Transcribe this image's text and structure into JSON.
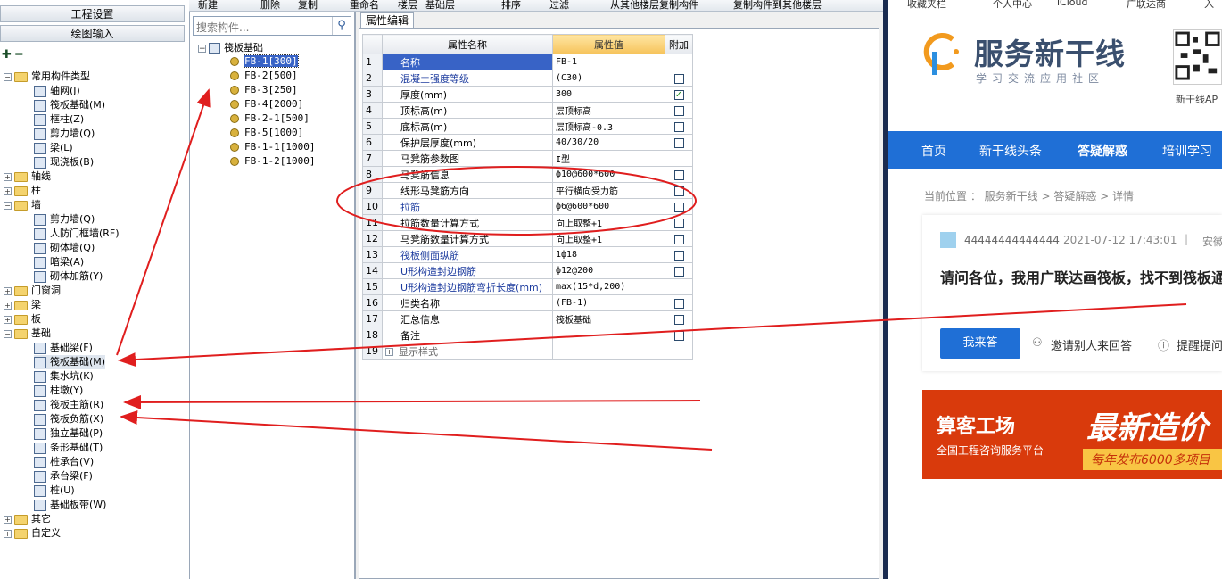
{
  "left_nav": {
    "buttons": [
      "工程设置",
      "绘图输入"
    ],
    "tree": [
      {
        "label": "常用构件类型",
        "level": 0,
        "expanded": true
      },
      {
        "label": "轴网(J)",
        "level": 1
      },
      {
        "label": "筏板基础(M)",
        "level": 1
      },
      {
        "label": "框柱(Z)",
        "level": 1
      },
      {
        "label": "剪力墙(Q)",
        "level": 1
      },
      {
        "label": "梁(L)",
        "level": 1
      },
      {
        "label": "现浇板(B)",
        "level": 1
      },
      {
        "label": "轴线",
        "level": 0,
        "expanded": false
      },
      {
        "label": "柱",
        "level": 0,
        "expanded": false
      },
      {
        "label": "墙",
        "level": 0,
        "expanded": true
      },
      {
        "label": "剪力墙(Q)",
        "level": 1
      },
      {
        "label": "人防门框墙(RF)",
        "level": 1
      },
      {
        "label": "砌体墙(Q)",
        "level": 1
      },
      {
        "label": "暗梁(A)",
        "level": 1
      },
      {
        "label": "砌体加筋(Y)",
        "level": 1
      },
      {
        "label": "门窗洞",
        "level": 0,
        "expanded": false
      },
      {
        "label": "梁",
        "level": 0,
        "expanded": false
      },
      {
        "label": "板",
        "level": 0,
        "expanded": false
      },
      {
        "label": "基础",
        "level": 0,
        "expanded": true
      },
      {
        "label": "基础梁(F)",
        "level": 1
      },
      {
        "label": "筏板基础(M)",
        "level": 1,
        "selected": true
      },
      {
        "label": "集水坑(K)",
        "level": 1
      },
      {
        "label": "柱墩(Y)",
        "level": 1
      },
      {
        "label": "筏板主筋(R)",
        "level": 1
      },
      {
        "label": "筏板负筋(X)",
        "level": 1
      },
      {
        "label": "独立基础(P)",
        "level": 1
      },
      {
        "label": "条形基础(T)",
        "level": 1
      },
      {
        "label": "桩承台(V)",
        "level": 1
      },
      {
        "label": "承台梁(F)",
        "level": 1
      },
      {
        "label": "桩(U)",
        "level": 1
      },
      {
        "label": "基础板带(W)",
        "level": 1
      },
      {
        "label": "其它",
        "level": 0,
        "expanded": false
      },
      {
        "label": "自定义",
        "level": 0,
        "expanded": false
      }
    ]
  },
  "toolbar": {
    "items": [
      "新建",
      "删除",
      "复制",
      "重命名",
      "楼层",
      "基础层",
      "排序",
      "过滤",
      "从其他楼层复制构件",
      "复制构件到其他楼层"
    ]
  },
  "components": {
    "search_placeholder": "搜索构件...",
    "root": "筏板基础",
    "items": [
      "FB-1[300]",
      "FB-2[500]",
      "FB-3[250]",
      "FB-4[2000]",
      "FB-2-1[500]",
      "FB-5[1000]",
      "FB-1-1[1000]",
      "FB-1-2[1000]"
    ]
  },
  "properties": {
    "tab": "属性编辑",
    "headers": {
      "name": "属性名称",
      "value": "属性值",
      "extra": "附加"
    },
    "rows": [
      {
        "n": "1",
        "name": "名称",
        "value": "FB-1",
        "blue": true,
        "check": null
      },
      {
        "n": "2",
        "name": "混凝土强度等级",
        "value": "(C30)",
        "blue": true,
        "check": false
      },
      {
        "n": "3",
        "name": "厚度(mm)",
        "value": "300",
        "blue": false,
        "check": true
      },
      {
        "n": "4",
        "name": "顶标高(m)",
        "value": "层顶标高",
        "blue": false,
        "check": false
      },
      {
        "n": "5",
        "name": "底标高(m)",
        "value": "层顶标高-0.3",
        "blue": false,
        "check": false
      },
      {
        "n": "6",
        "name": "保护层厚度(mm)",
        "value": "40/30/20",
        "blue": false,
        "check": false
      },
      {
        "n": "7",
        "name": "马凳筋参数图",
        "value": "I型",
        "blue": false,
        "check": null
      },
      {
        "n": "8",
        "name": "马凳筋信息",
        "value": "ф10@600*600",
        "blue": false,
        "check": false
      },
      {
        "n": "9",
        "name": "线形马凳筋方向",
        "value": "平行横向受力筋",
        "blue": false,
        "check": false
      },
      {
        "n": "10",
        "name": "拉筋",
        "value": "ф6@600*600",
        "blue": true,
        "check": false
      },
      {
        "n": "11",
        "name": "拉筋数量计算方式",
        "value": "向上取整+1",
        "blue": false,
        "check": false
      },
      {
        "n": "12",
        "name": "马凳筋数量计算方式",
        "value": "向上取整+1",
        "blue": false,
        "check": false
      },
      {
        "n": "13",
        "name": "筏板侧面纵筋",
        "value": "1ф18",
        "blue": true,
        "check": false
      },
      {
        "n": "14",
        "name": "U形构造封边钢筋",
        "value": "ф12@200",
        "blue": true,
        "check": false
      },
      {
        "n": "15",
        "name": "U形构造封边钢筋弯折长度(mm)",
        "value": "max(15*d,200)",
        "blue": true,
        "check": null
      },
      {
        "n": "16",
        "name": "归类名称",
        "value": "(FB-1)",
        "blue": false,
        "check": false
      },
      {
        "n": "17",
        "name": "汇总信息",
        "value": "筏板基础",
        "blue": false,
        "check": false
      },
      {
        "n": "18",
        "name": "备注",
        "value": "",
        "blue": false,
        "check": false
      },
      {
        "n": "19",
        "name": "显示样式",
        "value": "",
        "blue": false,
        "check": null,
        "expander": true
      }
    ]
  },
  "browser": {
    "bookmarks": [
      "收藏夹栏",
      "个人中心",
      "iCloud",
      "广联达商",
      "入"
    ],
    "logo_text": "服务新干线",
    "logo_sub": "学习交流应用社区",
    "qr_label": "新干线AP",
    "nav": [
      "首页",
      "新干线头条",
      "答疑解惑",
      "培训学习"
    ],
    "breadcrumb": "当前位置 ： 服务新干线 > 答疑解惑 > 详情",
    "question": {
      "user": "44444444444444",
      "time": "2021-07-12 17:43:01",
      "separator": "|",
      "tag": "安徽",
      "title": "请问各位，我用广联达画筏板，找不到筏板通"
    },
    "answer_button": "我来答",
    "invite": "邀请别人来回答",
    "remind": "提醒提问",
    "banner": {
      "logo": "算客工场",
      "sub": "全国工程咨询服务平台",
      "big": "最新造价",
      "strip": "每年发布6000多项目"
    }
  },
  "colors": {
    "annotation_red": "#e01e1e",
    "nav_blue": "#1f6fd6",
    "selected_row": "#3863c6",
    "value_header": "#f6c35b",
    "banner_red": "#d93a0c"
  }
}
